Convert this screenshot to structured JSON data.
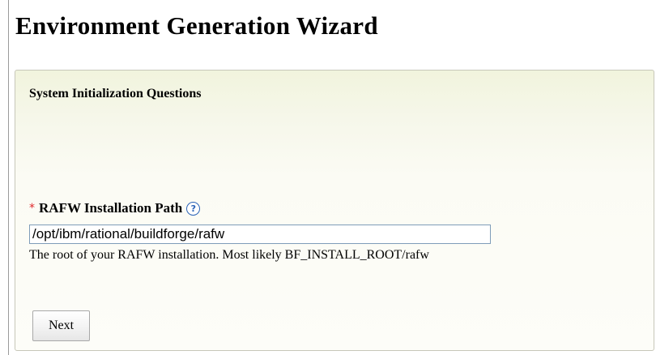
{
  "page": {
    "title": "Environment Generation Wizard"
  },
  "panel": {
    "section_title": "System Initialization Questions"
  },
  "field": {
    "required_marker": "*",
    "label": "RAFW Installation Path",
    "help_icon": "question-mark-icon",
    "help_glyph": "?",
    "value": "/opt/ibm/rational/buildforge/rafw",
    "description": "The root of your RAFW installation. Most likely BF_INSTALL_ROOT/rafw"
  },
  "actions": {
    "next_label": "Next"
  },
  "colors": {
    "required": "#e0292b",
    "help_icon": "#2a63b6",
    "panel_background": "#f4f6e4",
    "input_border": "#7f9db9"
  }
}
